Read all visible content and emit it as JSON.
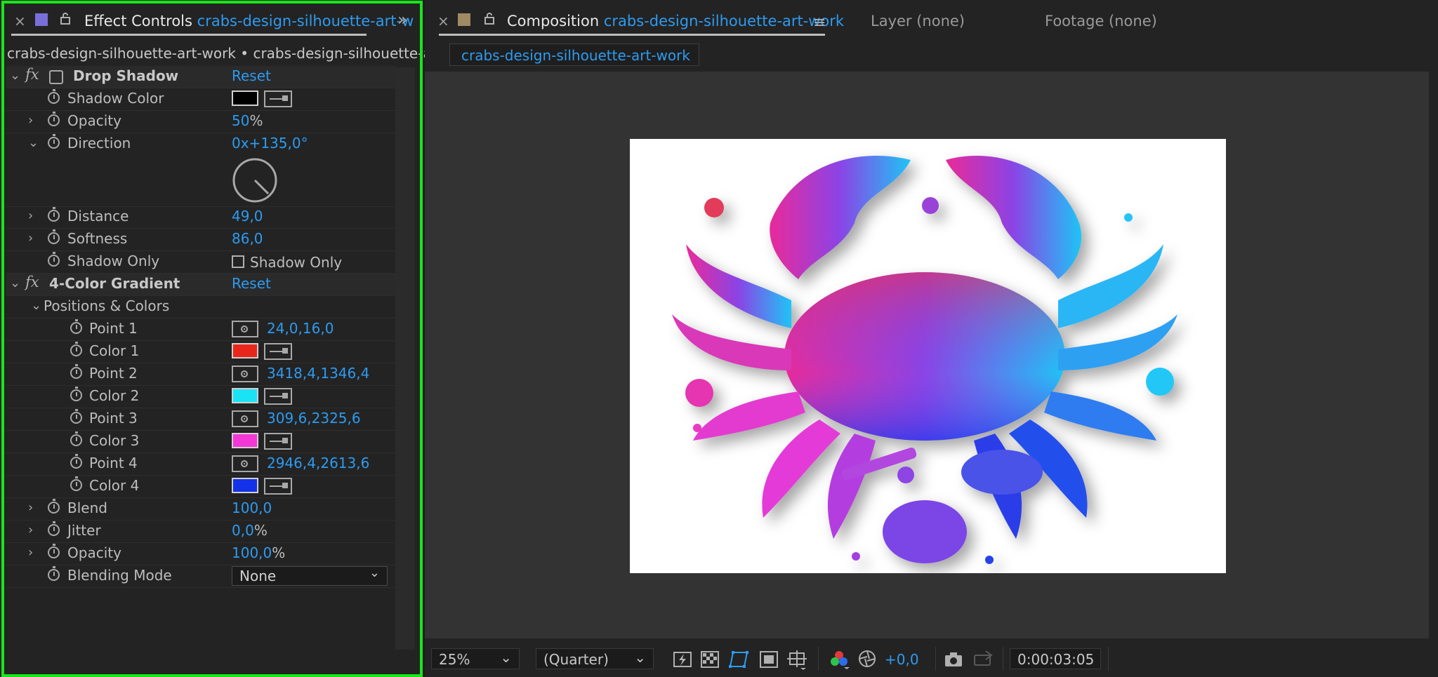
{
  "effect_controls": {
    "tab_title": "Effect Controls",
    "tab_comp": "crabs-design-silhouette-art-w",
    "breadcrumb": "crabs-design-silhouette-art-work • crabs-design-silhouette-art-w",
    "drop_shadow": {
      "name": "Drop Shadow",
      "reset": "Reset",
      "shadow_color_label": "Shadow Color",
      "shadow_color": "#000000",
      "opacity_label": "Opacity",
      "opacity_value": "50",
      "opacity_unit": "%",
      "direction_label": "Direction",
      "direction_value": "0x+135,0°",
      "distance_label": "Distance",
      "distance_value": "49,0",
      "softness_label": "Softness",
      "softness_value": "86,0",
      "shadow_only_label": "Shadow Only",
      "shadow_only_checkbox": "Shadow Only"
    },
    "gradient": {
      "name": "4-Color Gradient",
      "reset": "Reset",
      "positions_colors_label": "Positions & Colors",
      "point1_label": "Point 1",
      "point1_value": "24,0,16,0",
      "color1_label": "Color 1",
      "color1": "#e8271a",
      "point2_label": "Point 2",
      "point2_value": "3418,4,1346,4",
      "color2_label": "Color 2",
      "color2": "#19e3f5",
      "point3_label": "Point 3",
      "point3_value": "309,6,2325,6",
      "color3_label": "Color 3",
      "color3": "#f337d6",
      "point4_label": "Point 4",
      "point4_value": "2946,4,2613,6",
      "color4_label": "Color 4",
      "color4": "#1432e8",
      "blend_label": "Blend",
      "blend_value": "100,0",
      "jitter_label": "Jitter",
      "jitter_value": "0,0",
      "jitter_unit": "%",
      "opacity_label": "Opacity",
      "opacity_value": "100,0",
      "opacity_unit": "%",
      "blending_mode_label": "Blending Mode",
      "blending_mode_value": "None"
    }
  },
  "composition": {
    "tab_title": "Composition",
    "tab_comp": "crabs-design-silhouette-art-work",
    "layer_tab": "Layer (none)",
    "footage_tab": "Footage (none)",
    "comp_chip": "crabs-design-silhouette-art-work"
  },
  "viewer_controls": {
    "zoom": "25%",
    "resolution": "(Quarter)",
    "exposure": "+0,0",
    "timecode": "0:00:03:05"
  }
}
